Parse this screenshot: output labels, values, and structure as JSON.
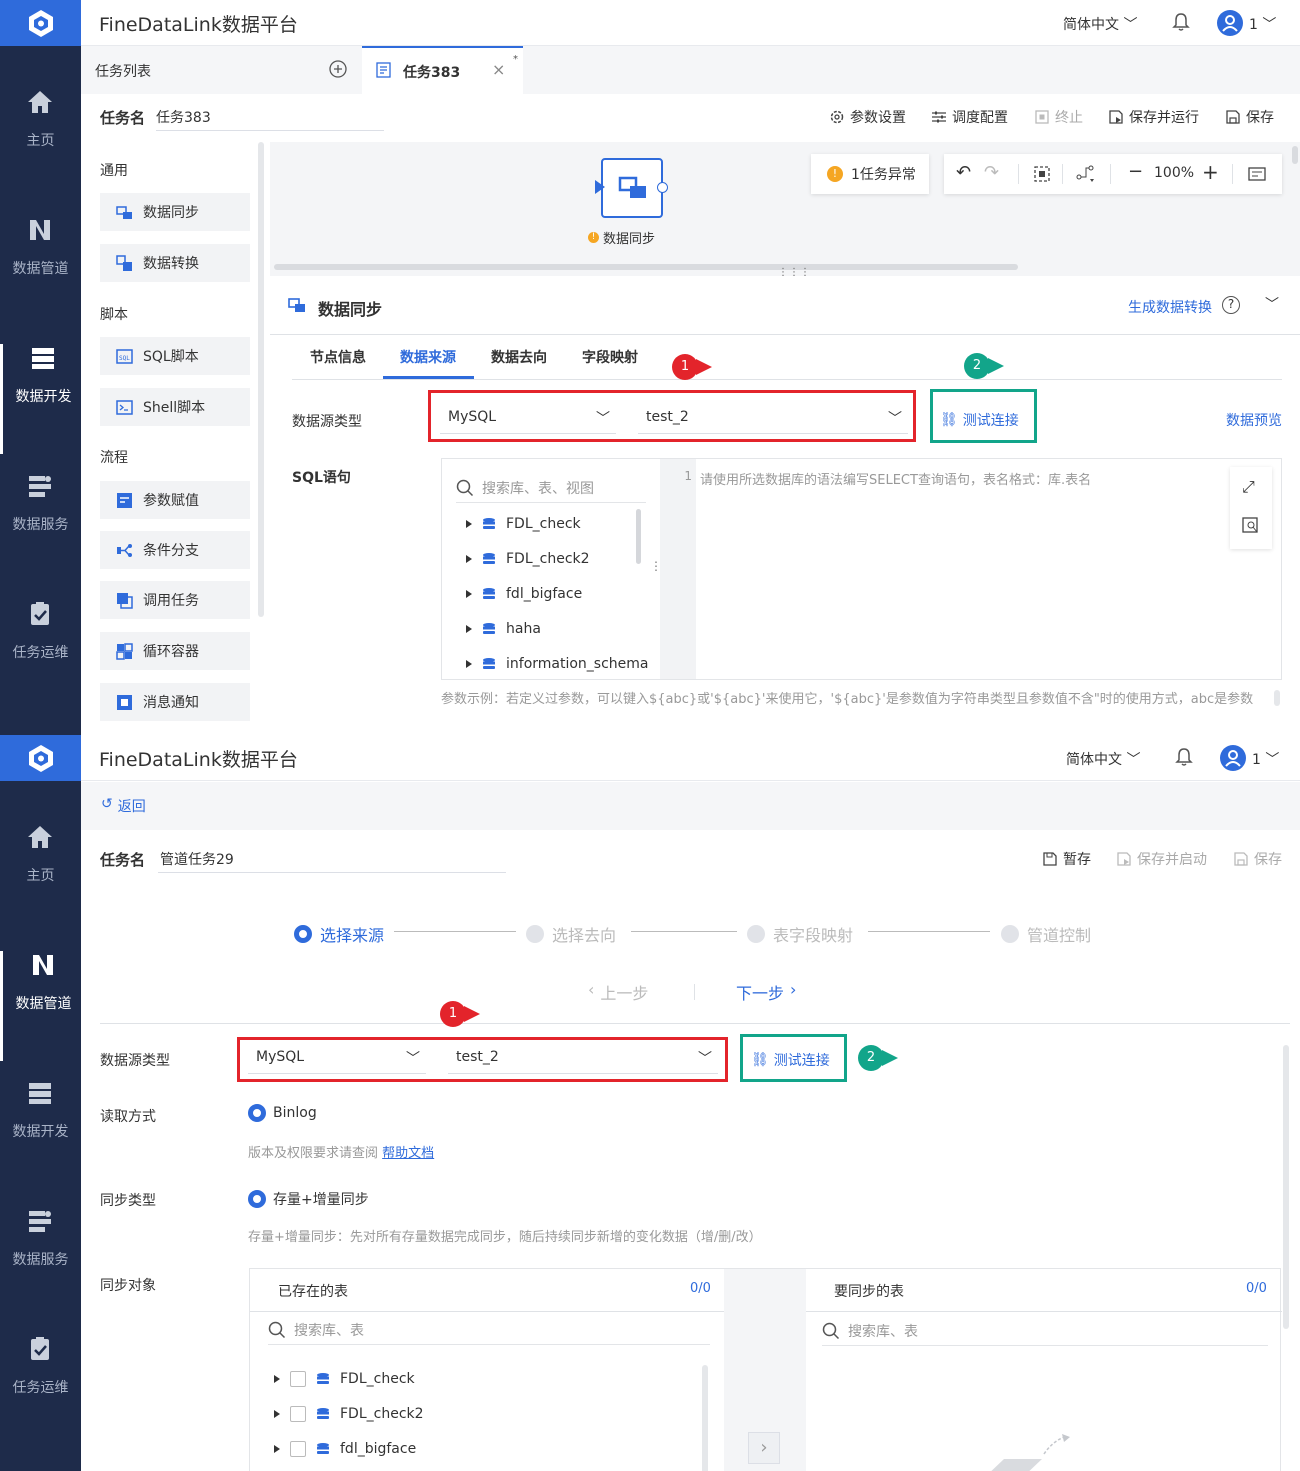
{
  "app": {
    "brand": "FineDataLink数据平台",
    "language": "简体中文",
    "user_count": "1"
  },
  "sidebar_top": [
    {
      "label": "主页",
      "icon": "home-icon"
    },
    {
      "label": "数据管道",
      "icon": "pipeline-icon"
    },
    {
      "label": "数据开发",
      "icon": "develop-icon"
    },
    {
      "label": "数据服务",
      "icon": "service-icon"
    },
    {
      "label": "任务运维",
      "icon": "ops-icon"
    }
  ],
  "dev": {
    "tabs": {
      "list": "任务列表",
      "task": "任务383"
    },
    "task_name_label": "任务名",
    "task_name_value": "任务383",
    "toolbar": {
      "params": "参数设置",
      "schedule": "调度配置",
      "stop": "终止",
      "save_run": "保存并运行",
      "save": "保存"
    },
    "groups": {
      "general": "通用",
      "script": "脚本",
      "flow": "流程"
    },
    "tools": {
      "sync": "数据同步",
      "transform": "数据转换",
      "sql": "SQL脚本",
      "shell": "Shell脚本",
      "assign": "参数赋值",
      "branch": "条件分支",
      "call": "调用任务",
      "loop": "循环容器",
      "notify": "消息通知"
    },
    "canvas": {
      "node_label": "数据同步",
      "error_badge": "1任务异常",
      "zoom": "100%"
    },
    "detail": {
      "title": "数据同步",
      "gen_transform": "生成数据转换",
      "tabs": [
        "节点信息",
        "数据来源",
        "数据去向",
        "字段映射"
      ],
      "source_type_label": "数据源类型",
      "db_type": "MySQL",
      "db_name": "test_2",
      "test_conn": "测试连接",
      "preview": "数据预览",
      "sql_label": "SQL语句",
      "search_placeholder": "搜索库、表、视图",
      "tree": [
        "FDL_check",
        "FDL_check2",
        "fdl_bigface",
        "haha",
        "information_schema"
      ],
      "line_no": "1",
      "sql_placeholder": "请使用所选数据库的语法编写SELECT查询语句，表名格式：库.表名",
      "param_hint": "参数示例：若定义过参数，可以键入${abc}或'${abc}'来使用它，'${abc}'是参数值为字符串类型且参数值不含\"时的使用方式，abc是参数"
    },
    "badges": {
      "one": "1",
      "two": "2"
    }
  },
  "pipe": {
    "back": "返回",
    "task_name_label": "任务名",
    "task_name_value": "管道任务29",
    "toolbar": {
      "draft": "暂存",
      "save_start": "保存并启动",
      "save": "保存"
    },
    "steps": [
      "选择来源",
      "选择去向",
      "表字段映射",
      "管道控制"
    ],
    "prev": "上一步",
    "next": "下一步",
    "source_type_label": "数据源类型",
    "db_type": "MySQL",
    "db_name": "test_2",
    "test_conn": "测试连接",
    "read_mode_label": "读取方式",
    "read_mode": "Binlog",
    "version_hint": "版本及权限要求请查阅",
    "help_doc": "帮助文档",
    "sync_type_label": "同步类型",
    "sync_type": "存量+增量同步",
    "sync_type_hint": "存量+增量同步：先对所有存量数据完成同步，随后持续同步新增的变化数据（增/删/改）",
    "sync_obj_label": "同步对象",
    "existing_tables": "已存在的表",
    "existing_count": "0/0",
    "target_tables": "要同步的表",
    "target_count": "0/0",
    "search_placeholder": "搜索库、表",
    "tree": [
      "FDL_check",
      "FDL_check2",
      "fdl_bigface"
    ],
    "badges": {
      "one": "1",
      "two": "2"
    }
  },
  "colors": {
    "sidebar": "#1e2b4a",
    "logo": "#2f6bdb",
    "accent": "#2f6bdb",
    "red": "#e3242b",
    "green": "#12a58a"
  }
}
